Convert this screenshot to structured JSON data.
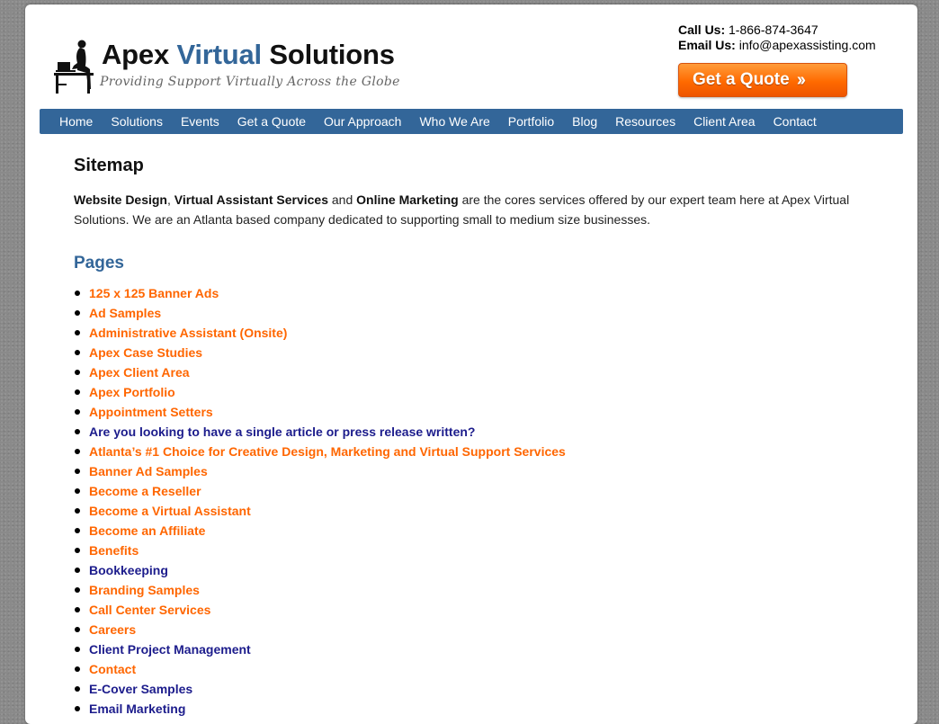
{
  "header": {
    "logo_word1": "Apex",
    "logo_word2": "Virtual",
    "logo_word3": "Solutions",
    "tagline": "Providing Support Virtually Across the Globe",
    "call_label": "Call Us:",
    "call_value": "1-866-874-3647",
    "email_label": "Email Us:",
    "email_value": "info@apexassisting.com",
    "quote_button": "Get a Quote",
    "quote_button_icon": "double-chevron-right-icon"
  },
  "nav": {
    "items": [
      "Home",
      "Solutions",
      "Events",
      "Get a Quote",
      "Our Approach",
      "Who We Are",
      "Portfolio",
      "Blog",
      "Resources",
      "Client Area",
      "Contact"
    ]
  },
  "main": {
    "title": "Sitemap",
    "intro": {
      "b1": "Website Design",
      "sep1": ", ",
      "b2": "Virtual Assistant Services",
      "sep2": " and ",
      "b3": "Online Marketing",
      "rest": " are the cores services offered by our expert team here at Apex Virtual Solutions. We are an Atlanta based company dedicated to supporting small to medium size businesses."
    },
    "pages_heading": "Pages",
    "pages": [
      {
        "label": "125 x 125 Banner Ads",
        "visited": false
      },
      {
        "label": "Ad Samples",
        "visited": false
      },
      {
        "label": "Administrative Assistant (Onsite)",
        "visited": false
      },
      {
        "label": "Apex Case Studies",
        "visited": false
      },
      {
        "label": "Apex Client Area",
        "visited": false
      },
      {
        "label": "Apex Portfolio",
        "visited": false
      },
      {
        "label": "Appointment Setters",
        "visited": false
      },
      {
        "label": "Are you looking to have a single article or press release written?",
        "visited": true
      },
      {
        "label": "Atlanta’s #1 Choice for Creative Design, Marketing and Virtual Support Services",
        "visited": false
      },
      {
        "label": "Banner Ad Samples",
        "visited": false
      },
      {
        "label": "Become a Reseller",
        "visited": false
      },
      {
        "label": "Become a Virtual Assistant",
        "visited": false
      },
      {
        "label": "Become an Affiliate",
        "visited": false
      },
      {
        "label": "Benefits",
        "visited": false
      },
      {
        "label": "Bookkeeping",
        "visited": true
      },
      {
        "label": "Branding Samples",
        "visited": false
      },
      {
        "label": "Call Center Services",
        "visited": false
      },
      {
        "label": "Careers",
        "visited": false
      },
      {
        "label": "Client Project Management",
        "visited": true
      },
      {
        "label": "Contact",
        "visited": false
      },
      {
        "label": "E-Cover Samples",
        "visited": true
      },
      {
        "label": "Email Marketing",
        "visited": true
      }
    ]
  },
  "colors": {
    "brand_blue": "#336699",
    "link_orange": "#ff6600",
    "link_visited": "#1c1c8c",
    "button_orange": "#ff6a00"
  }
}
